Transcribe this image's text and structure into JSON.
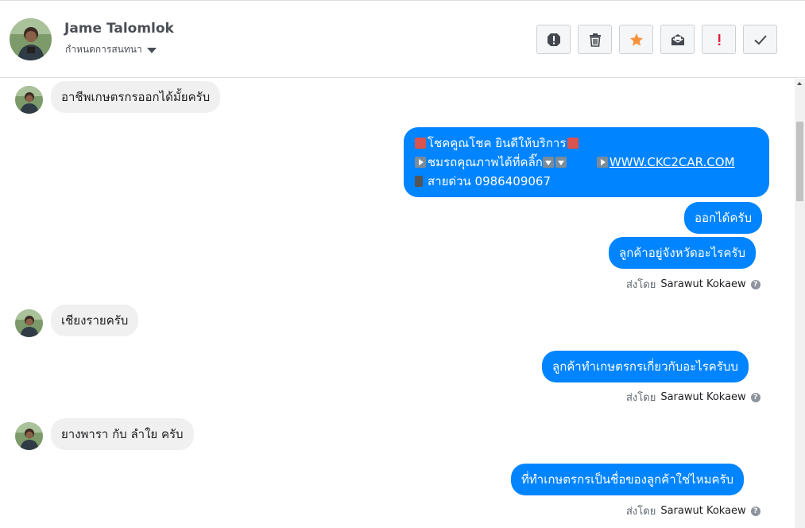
{
  "header": {
    "contact_name": "Jame Talomlok",
    "conversation_setting": "กำหนดการสนทนา"
  },
  "toolbar": [
    {
      "name": "spam-icon"
    },
    {
      "name": "trash-icon"
    },
    {
      "name": "star-icon"
    },
    {
      "name": "mark-unread-icon"
    },
    {
      "name": "follow-up-icon"
    },
    {
      "name": "done-check-icon"
    }
  ],
  "messages": {
    "m1": "อาชีพเกษตรกรออกได้มั้ยครับ",
    "m2_line1": "โชคคูณโชค ยินดีให้บริการ",
    "m2_line2a": "ชมรถคุณภาพได้ที่คลิ๊ก",
    "m2_link": "WWW.CKC2CAR.COM",
    "m2_line3": "สายด่วน 0986409067",
    "m3": "ออกได้ครับ",
    "m4": "ลูกค้าอยู่จังหวัดอะไรครับ",
    "m5": "เชียงรายครับ",
    "m6": "ลูกค้าทำเกษตรกรเกี่ยวกับอะไรครับบ",
    "m7": "ยางพารา กับ ลำใย ครับ",
    "m8": "ที่ทำเกษตรกรเป็นชื่อของลูกค้าใช่ไหมครับ"
  },
  "sent_by": {
    "prefix": "ส่งโดย",
    "name": "Sarawut Kokaew"
  },
  "colors": {
    "outgoing_bubble": "#0084ff",
    "incoming_bubble": "#f1f0f0",
    "star": "#f7923b",
    "alert": "#e41e3f"
  }
}
